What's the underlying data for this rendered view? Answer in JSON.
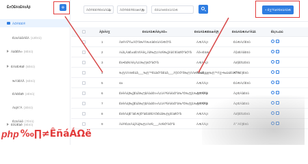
{
  "sidebar": {
    "title": "Ê≠ÖÈ¢òÈ¢òÂ∫ì",
    "add_label": "+",
    "items": [
      {
        "label": "ÂÖ®ÈÉ®",
        "count": ""
      },
      {
        "label": "Ê≠£ÂàôÁßÄ",
        "count": "(12È¢ò)"
      },
      {
        "label": "ÂàõÊñ∞",
        "count": "(8È¢ò)"
      },
      {
        "label": "ÈÄöËÆØ",
        "count": "(5È¢ò)"
      },
      {
        "label": "‰ºòËÄÅ",
        "count": "(6È¢ò)"
      },
      {
        "label": "ËÄÉËØï",
        "count": "(4È¢ò)"
      },
      {
        "label": "Âü∫Á°Ä",
        "count": "(3È¢ò)"
      },
      {
        "label": "Ê≠£Âàô",
        "count": "(7È¢ò)"
      },
      {
        "label": "ÈõÜÊàê",
        "count": "(9È¢ò)"
      }
    ]
  },
  "toolbar": {
    "select_1": "ÂÖ®ÈÉ®È¢òÂûã",
    "select_2": "ÂÖ®ÈÉ®ÈöæÂ∫¶",
    "search_placeholder": "ÊêúÁ¥¢È¢òÁõÆ",
    "add_question_label": "+ Ê∑ªÂäÝÈ¢òÁõÆ"
  },
  "table": {
    "headers": {
      "index": "Â∫èÂè∑",
      "name": "È¢òÁõÆÂêçÁß∞",
      "difficulty": "È¢òÁõÆÈöæÂ∫¶",
      "type": "È¢òÁõÆÁ±ªÂûã",
      "ops": "Êìç‰Ωú"
    },
    "rows": [
      {
        "index": "1",
        "name": "Âä®ÁîªÂ±ÄÔºà‰ªÄ‰πàÈ¢òÁõÆÔºâ",
        "difficulty": "ÁÆÄÂçï",
        "type": "ÈóÆÁ≠îÈ¢ò"
      },
      {
        "index": "2",
        "name": "Áúã„ÄäÊ±üÊπñÂêç„Äã‰∏≠ÁöÑ‰∫∫Áâ©ÊòØÔºàÔºâ",
        "difficulty": "Âõ∞Èöæ",
        "type": "Â§öÈÄâÈ¢ò"
      },
      {
        "index": "3",
        "name": "Êü•ËØ¢ÂêçÂ≠ó‰∏äÔºàÔºâ",
        "difficulty": "ÁÆÄÂçï",
        "type": "Âà§Êñ≠È¢ò"
      },
      {
        "index": "4",
        "name": "‰∏ÄÂπ¥Êúâ___‰∏™ÊúàÔºåÊúâ___Â§©Ôºå‰∏ÄÂë®Êúâ___‰∏™Â∑•‰ΩúÊó•Ôºü",
        "difficulty": "Âõ∞Èöæ",
        "type": "Â°´Á©∫È¢ò"
      },
      {
        "index": "5",
        "name": "4a",
        "difficulty": "ÁÆÄÂçï",
        "type": "ÈóÆÁ≠îÈ¢ò"
      },
      {
        "index": "6",
        "name": "ÊèêÂá∫‰∫∫Êúâ‰∏ãÂàóÊï∞Â≠óÁªÑÂêàÔºà‰ªÖ‰∏∫1‰∏™Ôºâ",
        "difficulty": "ÁÆÄÂçï",
        "type": "ÂçïÈÄâÈ¢ò"
      },
      {
        "index": "7",
        "name": "ÊèêÂá∫‰∫∫Êúâ‰∏ãÂàóÊï∞Â≠óÁªÑÂêàÔºà‰ªÖ‰∏∫1‰∏™Ôºâ",
        "difficulty": "ÁÆÄÂçï",
        "type": "ÂçïÈÄâÈ¢ò"
      },
      {
        "index": "8",
        "name": "ÊèêÂá∫Ê°àËÆ∫ÔºàÊàñËÄÖÊúâ‰∏çÊòØÔºâ",
        "difficulty": "ÁÆÄÂçï",
        "type": "Âà§Êñ≠È¢ò"
      },
      {
        "index": "9",
        "name": "Âú®Ê≠£Âú∫Âú∫‰∏≠ÁöÑ___ÁöÑÔºàÔºâ",
        "difficulty": "ÁÆÄÂçï",
        "type": "Â°´Á©∫È¢ò"
      }
    ]
  },
  "watermark": {
    "logo": "php",
    "text": "‰∏≠ÊñáÁΩë"
  },
  "colors": {
    "accent": "#2f7de1",
    "highlight": "#e23b3b"
  }
}
